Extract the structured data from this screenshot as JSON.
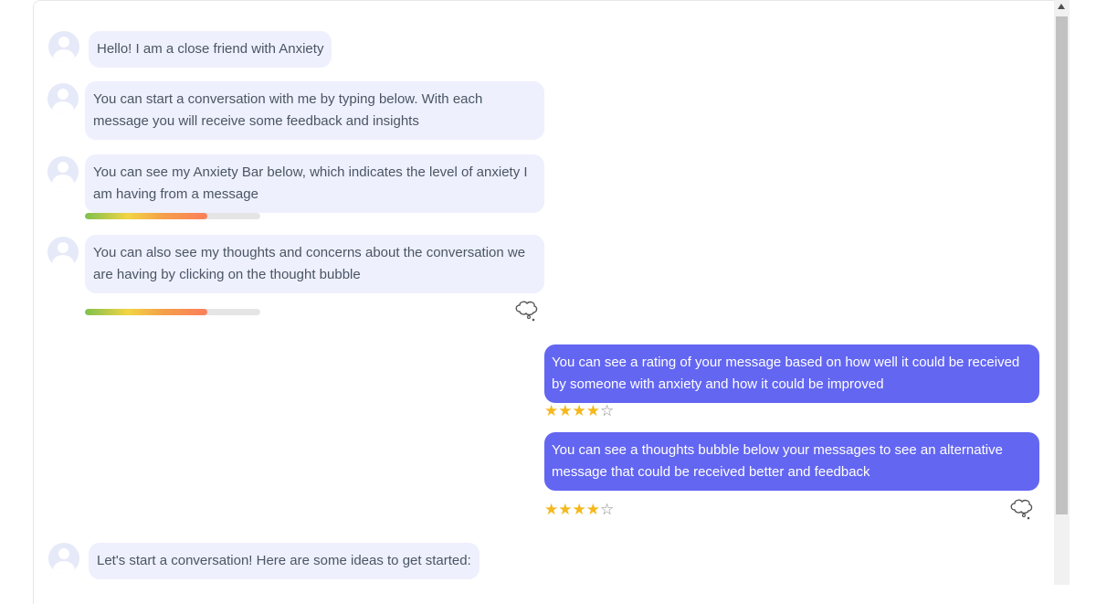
{
  "messages": [
    {
      "role": "ai",
      "text": "Hello! I am a close friend with Anxiety"
    },
    {
      "role": "ai",
      "text": "You can start a conversation with me by typing below. With each message you will receive some feedback and insights"
    },
    {
      "role": "ai",
      "text": "You can see my Anxiety Bar below, which indicates the level of anxiety I am having from a message",
      "anxiety_level": 0.7
    },
    {
      "role": "ai",
      "text": "You can also see my thoughts and concerns about the conversation we are having by clicking on the thought bubble",
      "anxiety_level": 0.7,
      "thought_icon": "thought-bubble-icon"
    },
    {
      "role": "user",
      "text": "You can see a rating of your message based on how well it could be received by someone with anxiety and how it could be improved",
      "rating": 4,
      "rating_max": 5
    },
    {
      "role": "user",
      "text": "You can see a thoughts bubble below your messages to see an alternative message that could be received better and feedback",
      "rating": 4,
      "rating_max": 5,
      "thought_icon": "thought-bubble-icon"
    },
    {
      "role": "ai",
      "text": "Let's start a conversation! Here are some ideas to get started:"
    }
  ],
  "stars": {
    "full": "★★★★",
    "empty": "☆"
  },
  "colors": {
    "ai_bubble": "#eef0fd",
    "user_bubble": "#6366f1",
    "star": "#f5b81c"
  }
}
